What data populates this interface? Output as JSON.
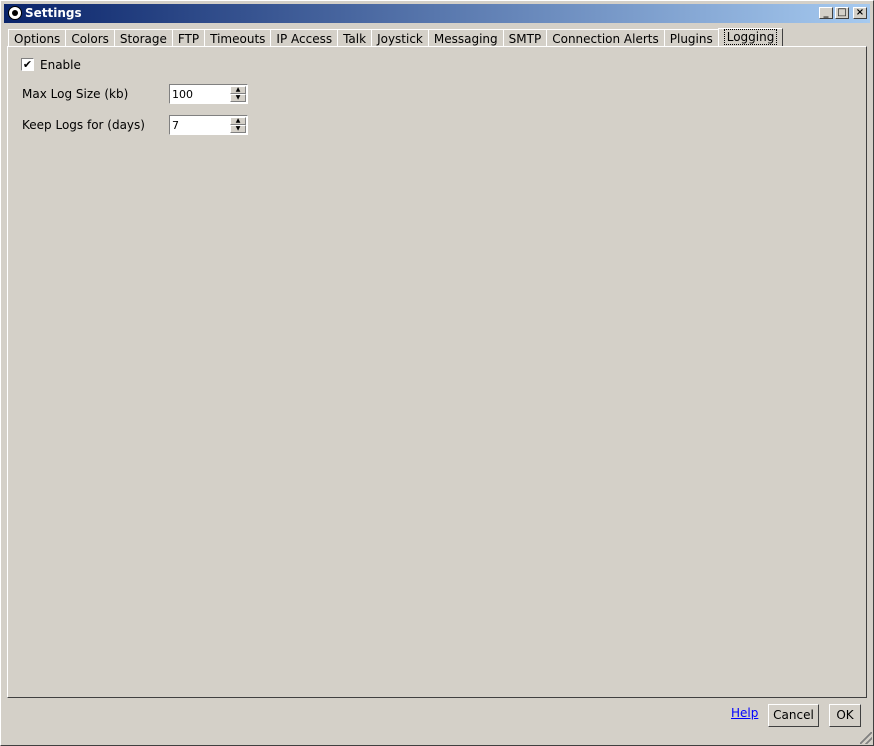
{
  "window": {
    "title": "Settings",
    "controls": {
      "minimize": "_",
      "maximize": "□",
      "close": "×"
    }
  },
  "tabs": [
    {
      "label": "Options"
    },
    {
      "label": "Colors"
    },
    {
      "label": "Storage"
    },
    {
      "label": "FTP"
    },
    {
      "label": "Timeouts"
    },
    {
      "label": "IP Access"
    },
    {
      "label": "Talk"
    },
    {
      "label": "Joystick"
    },
    {
      "label": "Messaging"
    },
    {
      "label": "SMTP"
    },
    {
      "label": "Connection Alerts"
    },
    {
      "label": "Plugins"
    },
    {
      "label": "Logging",
      "active": true
    }
  ],
  "logging": {
    "enable_label": "Enable",
    "enable_checked": true,
    "check_glyph": "✔",
    "max_log_size_label": "Max Log Size (kb)",
    "max_log_size_value": "100",
    "keep_logs_label": "Keep Logs for (days)",
    "keep_logs_value": "7"
  },
  "footer": {
    "help_label": "Help",
    "cancel_label": "Cancel",
    "ok_label": "OK"
  },
  "icons": {
    "app": "app-eye-icon",
    "spin_up": "▲",
    "spin_down": "▼"
  },
  "colors": {
    "titlebar_start": "#0a246a",
    "titlebar_end": "#a6caf0",
    "face": "#d4d0c8",
    "link": "#0000ff"
  }
}
